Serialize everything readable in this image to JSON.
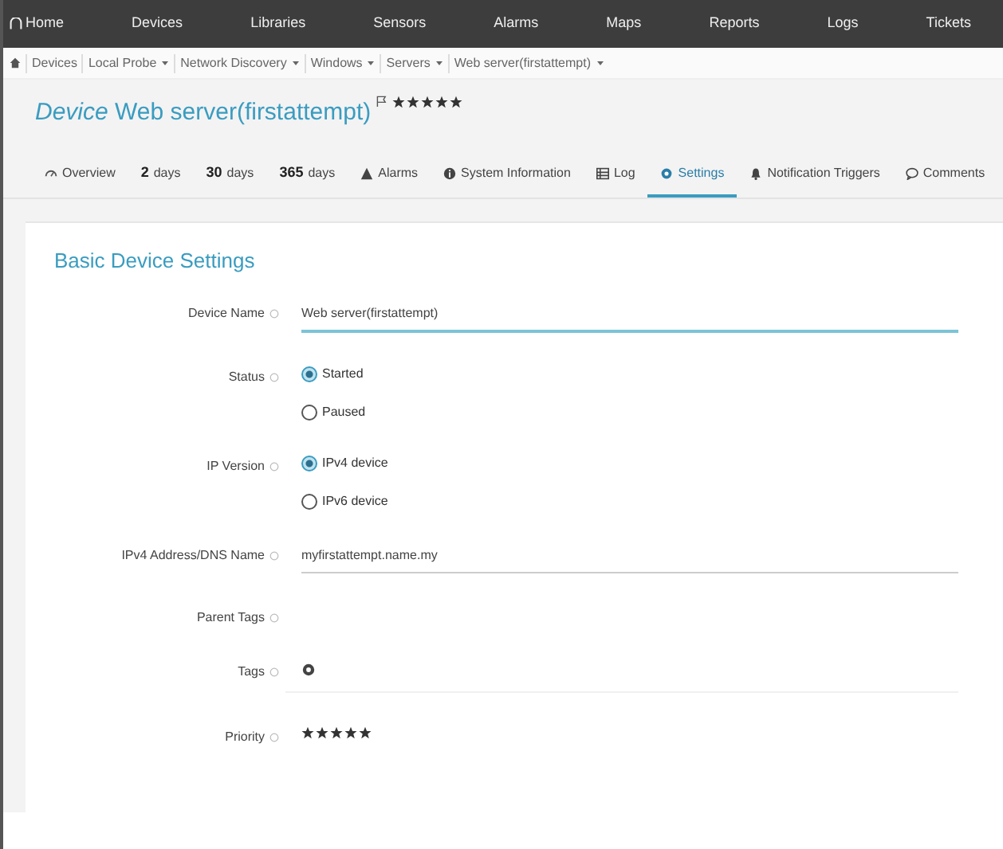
{
  "menu": [
    {
      "label": "Home"
    },
    {
      "label": "Devices"
    },
    {
      "label": "Libraries"
    },
    {
      "label": "Sensors"
    },
    {
      "label": "Alarms"
    },
    {
      "label": "Maps"
    },
    {
      "label": "Reports"
    },
    {
      "label": "Logs"
    },
    {
      "label": "Tickets"
    }
  ],
  "breadcrumbs": [
    {
      "label": "Devices",
      "dropdown": false
    },
    {
      "label": "Local Probe",
      "dropdown": true
    },
    {
      "label": "Network Discovery",
      "dropdown": true
    },
    {
      "label": "Windows",
      "dropdown": true
    },
    {
      "label": "Servers",
      "dropdown": true
    },
    {
      "label": "Web server(firstattempt)",
      "dropdown": true
    }
  ],
  "device": {
    "prefix": "Device",
    "name": "Web server(firstattempt)",
    "stars": 5
  },
  "tabs": [
    {
      "label": "Overview",
      "selected": false
    },
    {
      "number": "2",
      "label": "days",
      "selected": false
    },
    {
      "number": "30",
      "label": "days",
      "selected": false
    },
    {
      "number": "365",
      "label": "days",
      "selected": false
    },
    {
      "label": "Alarms",
      "selected": false
    },
    {
      "label": "System Information",
      "selected": false
    },
    {
      "label": "Log",
      "selected": false
    },
    {
      "label": "Settings",
      "selected": true
    },
    {
      "label": "Notification Triggers",
      "selected": false
    },
    {
      "label": "Comments",
      "selected": false
    }
  ],
  "section": {
    "title": "Basic Device Settings"
  },
  "fields": [
    {
      "kind": "text",
      "label": "Device Name",
      "value": "Web server(firstattempt)",
      "focused": true
    },
    {
      "kind": "radio",
      "label": "Status",
      "options": [
        {
          "label": "Started",
          "selected": true
        },
        {
          "label": "Paused",
          "selected": false
        }
      ]
    },
    {
      "kind": "radio",
      "label": "IP Version",
      "options": [
        {
          "label": "IPv4 device",
          "selected": true
        },
        {
          "label": "IPv6 device",
          "selected": false
        }
      ]
    },
    {
      "kind": "text",
      "label": "IPv4 Address/DNS Name",
      "value": "myfirstattempt.name.my",
      "focused": false
    },
    {
      "kind": "empty",
      "label": "Parent Tags"
    },
    {
      "kind": "tags",
      "label": "Tags"
    },
    {
      "kind": "stars",
      "label": "Priority",
      "stars": 5
    }
  ]
}
